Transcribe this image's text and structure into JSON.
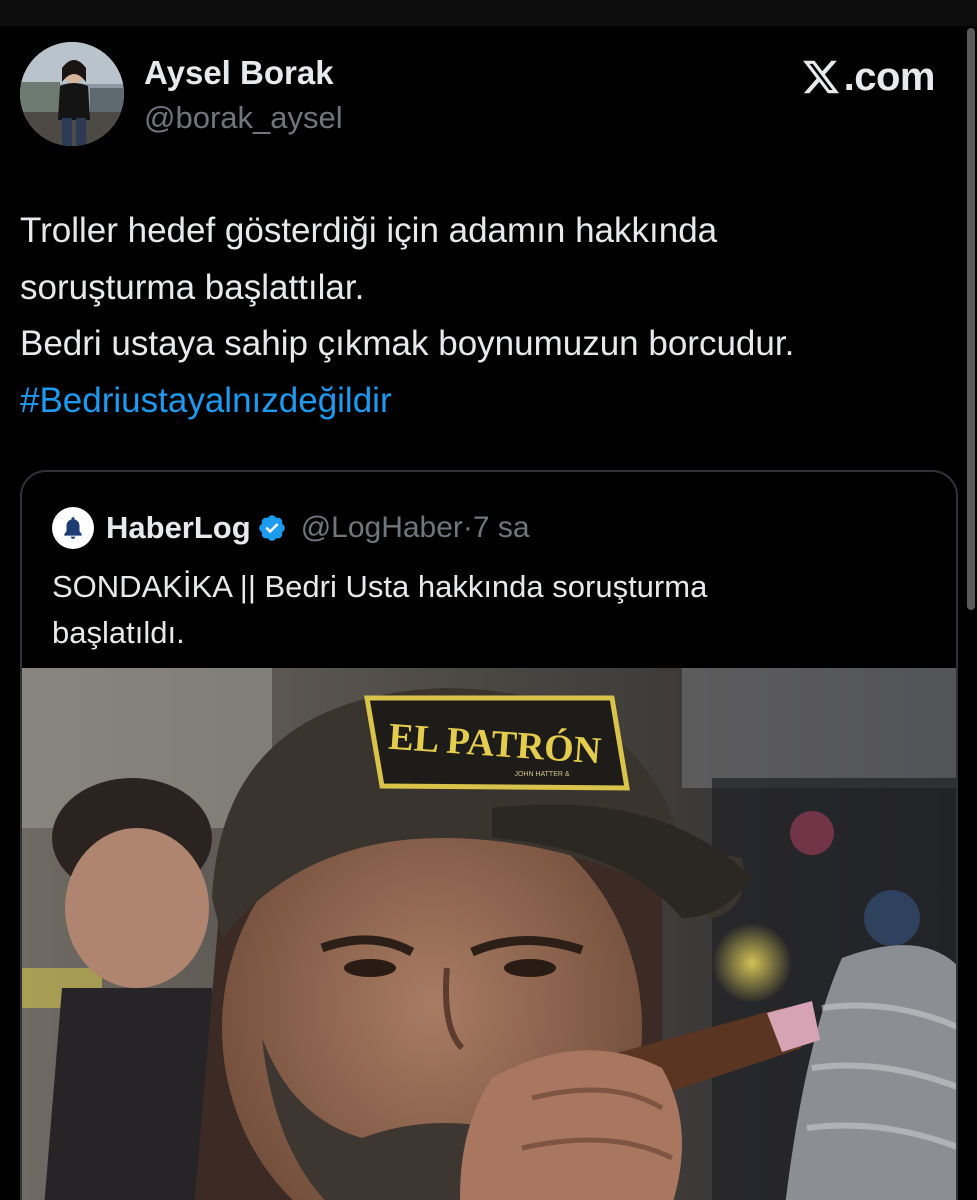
{
  "tweet": {
    "author": {
      "name": "Aysel Borak",
      "handle": "@borak_aysel"
    },
    "brand": {
      "text": ".com",
      "icon": "x-logo-icon"
    },
    "lines": [
      "Troller hedef gösterdiği için adamın hakkında",
      "soruşturma başlattılar.",
      "Bedri ustaya sahip çıkmak boynumuzun borcudur."
    ],
    "hashtag": "#Bedriustayalnızdeğildir"
  },
  "quote": {
    "name": "HaberLog",
    "handle": "@LogHaber",
    "separator": " · ",
    "time": "7 sa",
    "verified_icon": "verified-badge-icon",
    "logo_icon": "bell-icon",
    "lines": [
      "SONDAKİKA || Bedri Usta hakkında soruşturma",
      "başlatıldı."
    ],
    "image": {
      "cap_text": "EL PATRÓN",
      "cap_subtext": "JOHN HATTER &"
    }
  },
  "colors": {
    "background": "#000000",
    "text": "#e7e9ea",
    "muted": "#71767b",
    "link": "#1d9bf0",
    "border": "#2f3336"
  }
}
